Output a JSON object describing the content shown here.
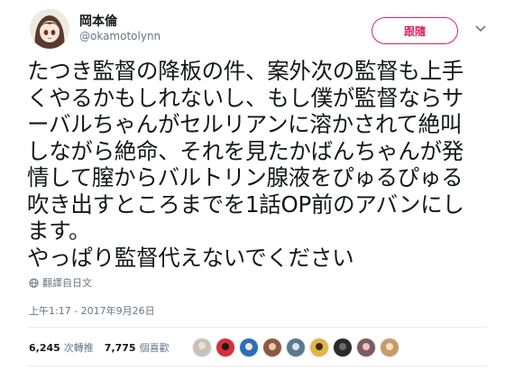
{
  "author": {
    "display_name": "岡本倫",
    "handle": "@okamotolynn"
  },
  "follow_button": {
    "label": "跟隨"
  },
  "tweet": {
    "lines": [
      "たつき監督の降板の件、案外次の監督も上手",
      "くやるかもしれないし、もし僕が監督ならサ",
      "ーバルちゃんがセルリアンに溶かされて絶叫",
      "しながら絶命、それを見たかばんちゃんが発",
      "情して膣からバルトリン腺液をぴゅるぴゅる",
      "吹き出すところまでを1話OP前のアバンにし",
      "ます。",
      "やっぱり監督代えないでください"
    ]
  },
  "translate": {
    "label": "翻譯自日文",
    "icon": "globe-icon"
  },
  "timestamp": "上午1:17 - 2017年9月26日",
  "stats": {
    "retweets_count": "6,245",
    "retweets_label": "次轉推",
    "likes_count": "7,775",
    "likes_label": "個喜歡"
  },
  "likers": [
    {
      "icon": "liker-avatar",
      "color": "#c9c2bc"
    },
    {
      "icon": "liker-avatar",
      "color": "#d2313a"
    },
    {
      "icon": "liker-avatar",
      "color": "#2c6fb6"
    },
    {
      "icon": "liker-avatar",
      "color": "#8a5a44"
    },
    {
      "icon": "liker-avatar",
      "color": "#5b7a8c"
    },
    {
      "icon": "liker-avatar",
      "color": "#e2b546"
    },
    {
      "icon": "liker-avatar",
      "color": "#2a2a2a"
    },
    {
      "icon": "liker-avatar",
      "color": "#7d5a63"
    },
    {
      "icon": "liker-avatar",
      "color": "#c79b68"
    }
  ],
  "colors": {
    "follow_accent": "#e0245e",
    "secondary_text": "#657786",
    "primary_text": "#14171a"
  }
}
